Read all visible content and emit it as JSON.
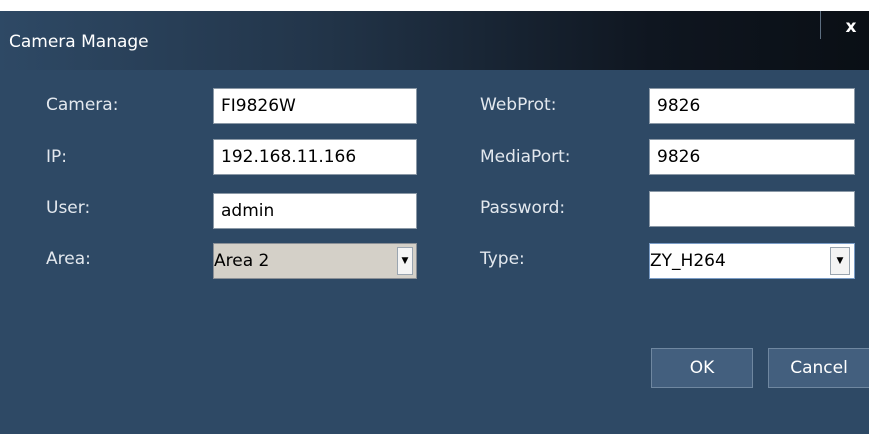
{
  "dialog": {
    "title": "Camera Manage",
    "close_label": "x"
  },
  "fields": {
    "camera": {
      "label": "Camera:",
      "value": "FI9826W"
    },
    "ip": {
      "label": "IP:",
      "value": "192.168.11.166"
    },
    "user": {
      "label": "User:",
      "value": "admin"
    },
    "area": {
      "label": "Area:",
      "value": "Area 2"
    },
    "web_port": {
      "label": "WebProt:",
      "value": "9826"
    },
    "media_port": {
      "label": "MediaPort:",
      "value": "9826"
    },
    "password": {
      "label": "Password:",
      "value": ""
    },
    "type": {
      "label": "Type:",
      "value": "ZY_H264"
    }
  },
  "buttons": {
    "ok": "OK",
    "cancel": "Cancel"
  },
  "icons": {
    "close": "close-icon",
    "dropdown": "triangle-down-icon",
    "dropdown_glyph": "▼"
  },
  "colors": {
    "dialog_bg": "#2e4965",
    "area_select_bg": "#d4d0c8",
    "type_select_border": "#7a9cc6",
    "button_bg": "#435f7e"
  }
}
